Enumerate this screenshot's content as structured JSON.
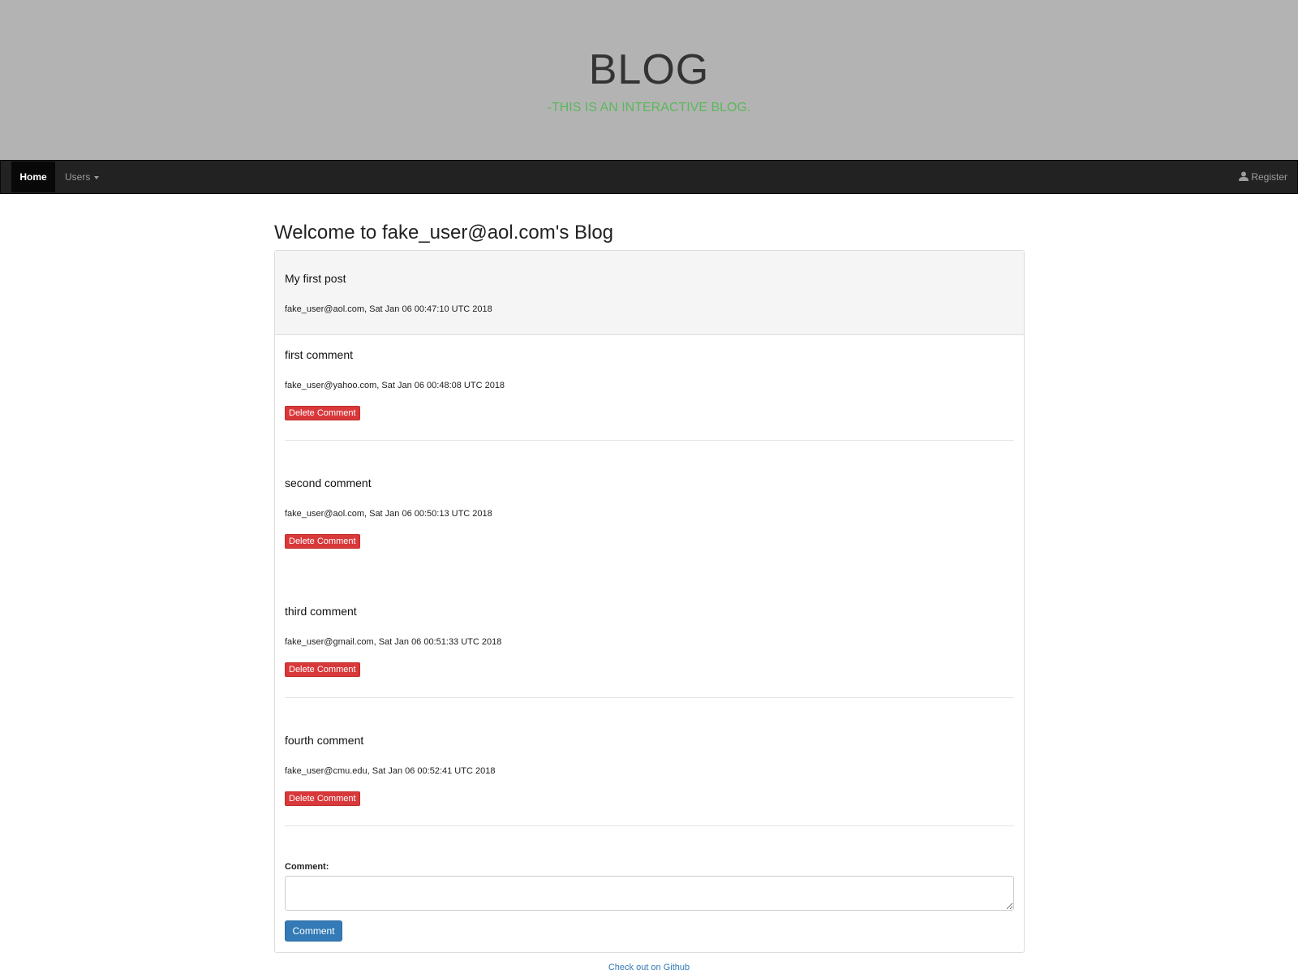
{
  "hero": {
    "title": "BLOG",
    "subtitle": "-THIS IS AN INTERACTIVE BLOG."
  },
  "nav": {
    "home_label": "Home",
    "users_label": "Users",
    "register_label": "Register",
    "register_icon": "user-icon"
  },
  "page": {
    "heading": "Welcome to fake_user@aol.com's Blog"
  },
  "post": {
    "title": "My first post",
    "meta": "fake_user@aol.com, Sat Jan 06 00:47:10 UTC 2018"
  },
  "comments": [
    {
      "text": "first comment",
      "meta": "fake_user@yahoo.com, Sat Jan 06 00:48:08 UTC 2018",
      "delete_label": "Delete Comment"
    },
    {
      "text": "second comment",
      "meta": "fake_user@aol.com, Sat Jan 06 00:50:13 UTC 2018",
      "delete_label": "Delete Comment"
    },
    {
      "text": "third comment",
      "meta": "fake_user@gmail.com, Sat Jan 06 00:51:33 UTC 2018",
      "delete_label": "Delete Comment"
    },
    {
      "text": "fourth comment",
      "meta": "fake_user@cmu.edu, Sat Jan 06 00:52:41 UTC 2018",
      "delete_label": "Delete Comment"
    }
  ],
  "form": {
    "label": "Comment:",
    "value": "",
    "submit_label": "Comment"
  },
  "footer": {
    "link_text": "Check out on Github"
  },
  "colors": {
    "hero_bg": "#b3b3b3",
    "subtitle": "#5cb85c",
    "navbar": "#222222",
    "danger": "#d9383a",
    "primary": "#337ab7"
  }
}
